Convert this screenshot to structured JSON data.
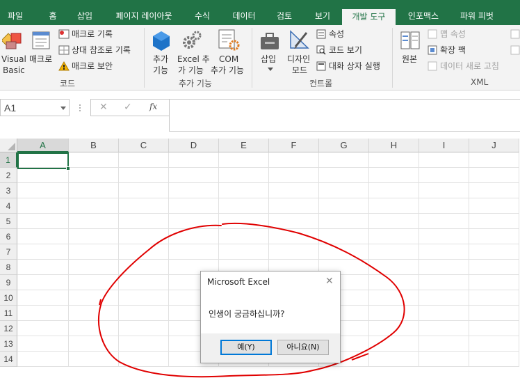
{
  "title_bar": {
    "text": ""
  },
  "tabs": [
    {
      "label": "파일"
    },
    {
      "label": "홈"
    },
    {
      "label": "삽입"
    },
    {
      "label": "페이지 레이아웃"
    },
    {
      "label": "수식"
    },
    {
      "label": "데이터"
    },
    {
      "label": "검토"
    },
    {
      "label": "보기"
    },
    {
      "label": "개발 도구",
      "active": true
    },
    {
      "label": "인포맥스"
    },
    {
      "label": "파워 피벗"
    }
  ],
  "ribbon": {
    "code": {
      "visual_basic_1": "Visual",
      "visual_basic_2": "Basic",
      "macro": "매크로",
      "record_macro": "매크로 기록",
      "relative_ref": "상대 참조로 기록",
      "macro_security": "매크로 보안",
      "group": "코드"
    },
    "addins": {
      "addins_1": "추가",
      "addins_2": "기능",
      "excel_addins_1": "Excel 추",
      "excel_addins_2": "가 기능",
      "com_addins_1": "COM",
      "com_addins_2": "추가 기능",
      "group": "추가 기능"
    },
    "controls": {
      "insert": "삽입",
      "design_mode_1": "디자인",
      "design_mode_2": "모드",
      "properties": "속성",
      "view_code": "코드 보기",
      "run_dialog": "대화 상자 실행",
      "group": "컨트롤"
    },
    "xml": {
      "source": "원본",
      "map_properties": "맵 속성",
      "expansion_packs": "확장 팩",
      "refresh_data": "데이터 새로 고침",
      "group": "XML"
    }
  },
  "formula_bar": {
    "name_box": "A1",
    "cancel": "✕",
    "enter": "✓",
    "fx": "fx",
    "value": ""
  },
  "grid": {
    "columns": [
      "A",
      "B",
      "C",
      "D",
      "E",
      "F",
      "G",
      "H",
      "I",
      "J"
    ],
    "rows": [
      "1",
      "2",
      "3",
      "4",
      "5",
      "6",
      "7",
      "8",
      "9",
      "10",
      "11",
      "12",
      "13",
      "14"
    ],
    "active_cell": "A1"
  },
  "dialog": {
    "title": "Microsoft Excel",
    "message": "인생이 궁금하십니까?",
    "yes_label": "예(Y)",
    "no_label": "아니요(N)"
  },
  "colors": {
    "accent": "#217346",
    "annotation": "#e00000"
  }
}
